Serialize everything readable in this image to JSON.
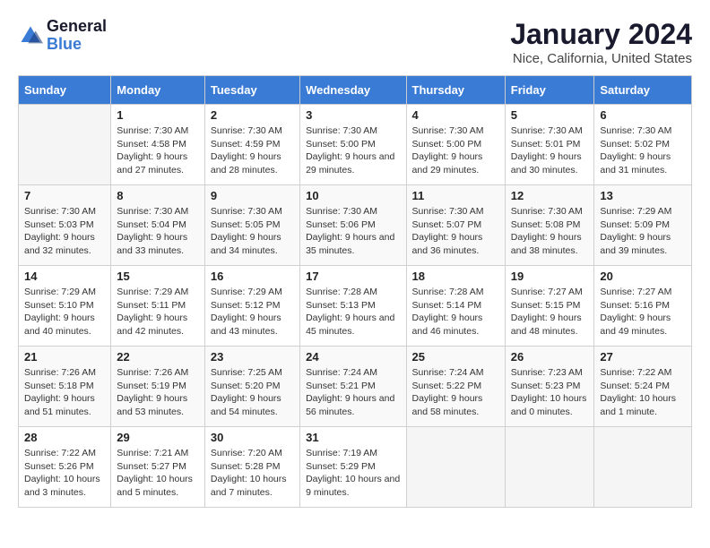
{
  "logo": {
    "text_general": "General",
    "text_blue": "Blue"
  },
  "title": "January 2024",
  "subtitle": "Nice, California, United States",
  "headers": [
    "Sunday",
    "Monday",
    "Tuesday",
    "Wednesday",
    "Thursday",
    "Friday",
    "Saturday"
  ],
  "weeks": [
    [
      {
        "day": "",
        "sunrise": "",
        "sunset": "",
        "daylight": ""
      },
      {
        "day": "1",
        "sunrise": "Sunrise: 7:30 AM",
        "sunset": "Sunset: 4:58 PM",
        "daylight": "Daylight: 9 hours and 27 minutes."
      },
      {
        "day": "2",
        "sunrise": "Sunrise: 7:30 AM",
        "sunset": "Sunset: 4:59 PM",
        "daylight": "Daylight: 9 hours and 28 minutes."
      },
      {
        "day": "3",
        "sunrise": "Sunrise: 7:30 AM",
        "sunset": "Sunset: 5:00 PM",
        "daylight": "Daylight: 9 hours and 29 minutes."
      },
      {
        "day": "4",
        "sunrise": "Sunrise: 7:30 AM",
        "sunset": "Sunset: 5:00 PM",
        "daylight": "Daylight: 9 hours and 29 minutes."
      },
      {
        "day": "5",
        "sunrise": "Sunrise: 7:30 AM",
        "sunset": "Sunset: 5:01 PM",
        "daylight": "Daylight: 9 hours and 30 minutes."
      },
      {
        "day": "6",
        "sunrise": "Sunrise: 7:30 AM",
        "sunset": "Sunset: 5:02 PM",
        "daylight": "Daylight: 9 hours and 31 minutes."
      }
    ],
    [
      {
        "day": "7",
        "sunrise": "Sunrise: 7:30 AM",
        "sunset": "Sunset: 5:03 PM",
        "daylight": "Daylight: 9 hours and 32 minutes."
      },
      {
        "day": "8",
        "sunrise": "Sunrise: 7:30 AM",
        "sunset": "Sunset: 5:04 PM",
        "daylight": "Daylight: 9 hours and 33 minutes."
      },
      {
        "day": "9",
        "sunrise": "Sunrise: 7:30 AM",
        "sunset": "Sunset: 5:05 PM",
        "daylight": "Daylight: 9 hours and 34 minutes."
      },
      {
        "day": "10",
        "sunrise": "Sunrise: 7:30 AM",
        "sunset": "Sunset: 5:06 PM",
        "daylight": "Daylight: 9 hours and 35 minutes."
      },
      {
        "day": "11",
        "sunrise": "Sunrise: 7:30 AM",
        "sunset": "Sunset: 5:07 PM",
        "daylight": "Daylight: 9 hours and 36 minutes."
      },
      {
        "day": "12",
        "sunrise": "Sunrise: 7:30 AM",
        "sunset": "Sunset: 5:08 PM",
        "daylight": "Daylight: 9 hours and 38 minutes."
      },
      {
        "day": "13",
        "sunrise": "Sunrise: 7:29 AM",
        "sunset": "Sunset: 5:09 PM",
        "daylight": "Daylight: 9 hours and 39 minutes."
      }
    ],
    [
      {
        "day": "14",
        "sunrise": "Sunrise: 7:29 AM",
        "sunset": "Sunset: 5:10 PM",
        "daylight": "Daylight: 9 hours and 40 minutes."
      },
      {
        "day": "15",
        "sunrise": "Sunrise: 7:29 AM",
        "sunset": "Sunset: 5:11 PM",
        "daylight": "Daylight: 9 hours and 42 minutes."
      },
      {
        "day": "16",
        "sunrise": "Sunrise: 7:29 AM",
        "sunset": "Sunset: 5:12 PM",
        "daylight": "Daylight: 9 hours and 43 minutes."
      },
      {
        "day": "17",
        "sunrise": "Sunrise: 7:28 AM",
        "sunset": "Sunset: 5:13 PM",
        "daylight": "Daylight: 9 hours and 45 minutes."
      },
      {
        "day": "18",
        "sunrise": "Sunrise: 7:28 AM",
        "sunset": "Sunset: 5:14 PM",
        "daylight": "Daylight: 9 hours and 46 minutes."
      },
      {
        "day": "19",
        "sunrise": "Sunrise: 7:27 AM",
        "sunset": "Sunset: 5:15 PM",
        "daylight": "Daylight: 9 hours and 48 minutes."
      },
      {
        "day": "20",
        "sunrise": "Sunrise: 7:27 AM",
        "sunset": "Sunset: 5:16 PM",
        "daylight": "Daylight: 9 hours and 49 minutes."
      }
    ],
    [
      {
        "day": "21",
        "sunrise": "Sunrise: 7:26 AM",
        "sunset": "Sunset: 5:18 PM",
        "daylight": "Daylight: 9 hours and 51 minutes."
      },
      {
        "day": "22",
        "sunrise": "Sunrise: 7:26 AM",
        "sunset": "Sunset: 5:19 PM",
        "daylight": "Daylight: 9 hours and 53 minutes."
      },
      {
        "day": "23",
        "sunrise": "Sunrise: 7:25 AM",
        "sunset": "Sunset: 5:20 PM",
        "daylight": "Daylight: 9 hours and 54 minutes."
      },
      {
        "day": "24",
        "sunrise": "Sunrise: 7:24 AM",
        "sunset": "Sunset: 5:21 PM",
        "daylight": "Daylight: 9 hours and 56 minutes."
      },
      {
        "day": "25",
        "sunrise": "Sunrise: 7:24 AM",
        "sunset": "Sunset: 5:22 PM",
        "daylight": "Daylight: 9 hours and 58 minutes."
      },
      {
        "day": "26",
        "sunrise": "Sunrise: 7:23 AM",
        "sunset": "Sunset: 5:23 PM",
        "daylight": "Daylight: 10 hours and 0 minutes."
      },
      {
        "day": "27",
        "sunrise": "Sunrise: 7:22 AM",
        "sunset": "Sunset: 5:24 PM",
        "daylight": "Daylight: 10 hours and 1 minute."
      }
    ],
    [
      {
        "day": "28",
        "sunrise": "Sunrise: 7:22 AM",
        "sunset": "Sunset: 5:26 PM",
        "daylight": "Daylight: 10 hours and 3 minutes."
      },
      {
        "day": "29",
        "sunrise": "Sunrise: 7:21 AM",
        "sunset": "Sunset: 5:27 PM",
        "daylight": "Daylight: 10 hours and 5 minutes."
      },
      {
        "day": "30",
        "sunrise": "Sunrise: 7:20 AM",
        "sunset": "Sunset: 5:28 PM",
        "daylight": "Daylight: 10 hours and 7 minutes."
      },
      {
        "day": "31",
        "sunrise": "Sunrise: 7:19 AM",
        "sunset": "Sunset: 5:29 PM",
        "daylight": "Daylight: 10 hours and 9 minutes."
      },
      {
        "day": "",
        "sunrise": "",
        "sunset": "",
        "daylight": ""
      },
      {
        "day": "",
        "sunrise": "",
        "sunset": "",
        "daylight": ""
      },
      {
        "day": "",
        "sunrise": "",
        "sunset": "",
        "daylight": ""
      }
    ]
  ]
}
